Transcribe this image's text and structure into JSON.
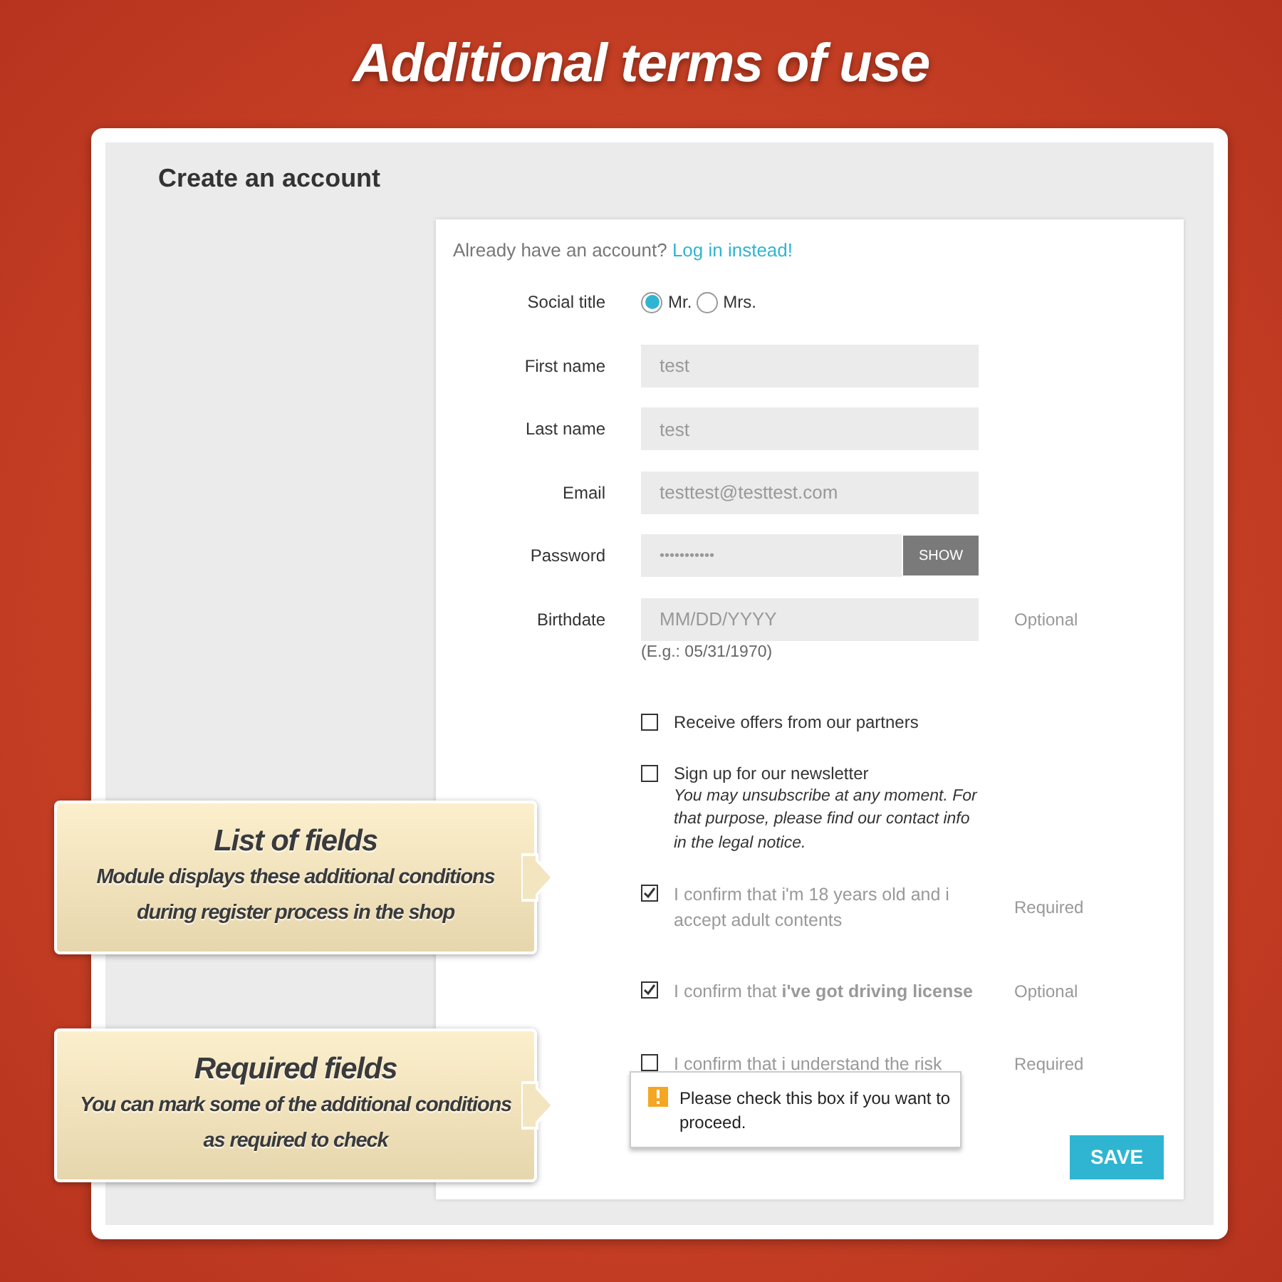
{
  "banner": {
    "title": "Additional terms of use"
  },
  "page": {
    "heading": "Create an account"
  },
  "login_prompt": {
    "text": "Already have an account?",
    "link": "Log in instead!"
  },
  "fields": [
    {
      "kind": "radio",
      "label": "Social title",
      "options": [
        {
          "label": "Mr.",
          "selected": true
        },
        {
          "label": "Mrs.",
          "selected": false
        }
      ]
    },
    {
      "kind": "text",
      "label": "First name",
      "value": "test"
    },
    {
      "kind": "text",
      "label": "Last name",
      "value": "test"
    },
    {
      "kind": "text",
      "label": "Email",
      "value": "testtest@testtest.com"
    },
    {
      "kind": "password",
      "label": "Password",
      "value": "•••••••••••",
      "button": "SHOW"
    },
    {
      "kind": "text",
      "label": "Birthdate",
      "placeholder": "MM/DD/YYYY",
      "note": "Optional",
      "hint": "(E.g.: 05/31/1970)"
    }
  ],
  "checkboxes": [
    {
      "kind": "option",
      "label": "Receive offers from our partners",
      "checked": false
    },
    {
      "kind": "option",
      "label": "Sign up for our newsletter",
      "description": "You may unsubscribe at any moment. For that purpose, please find our contact info in the legal notice.",
      "checked": false
    },
    {
      "kind": "term",
      "label": "I confirm that i'm 18 years old and i accept adult contents",
      "checked": true,
      "note": "Required"
    },
    {
      "kind": "term",
      "label": "I confirm that **i've got driving license**",
      "checked": true,
      "note": "Optional"
    },
    {
      "kind": "term",
      "label": "I confirm that i understand the risk",
      "checked": false,
      "note": "Required"
    }
  ],
  "tooltip": {
    "text": "Please check this box if you want to proceed."
  },
  "save_button": "SAVE",
  "callouts": [
    {
      "title": "List of fields",
      "text": "Module displays these additional conditions during register process in the shop"
    },
    {
      "title": "Required fields",
      "text": "You can mark some of the additional conditions as required to check"
    }
  ]
}
